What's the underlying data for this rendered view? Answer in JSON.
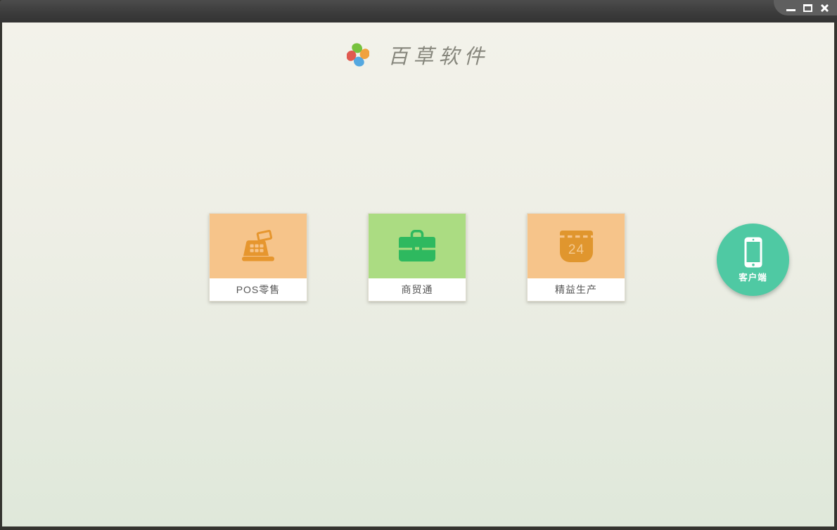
{
  "window": {
    "controls": {
      "minimize_icon": "minimize-icon",
      "maximize_icon": "maximize-icon",
      "close_icon": "close-icon"
    }
  },
  "header": {
    "title": "百草软件",
    "logo_icon": "pinwheel-icon",
    "logo_colors": {
      "top": "#76c23d",
      "right": "#f0a23e",
      "bottom": "#55a8e0",
      "left": "#e05a50"
    }
  },
  "products": [
    {
      "label": "POS零售",
      "icon": "cash-register-icon",
      "tile_color": "#f6c48a",
      "icon_color": "#e6962e"
    },
    {
      "label": "商贸通",
      "icon": "briefcase-icon",
      "tile_color": "#abdc82",
      "icon_color": "#2eb95f"
    },
    {
      "label": "精益生产",
      "icon": "calendar-icon",
      "calendar_day": "24",
      "tile_color": "#f6c48a",
      "icon_color": "#e0962e"
    }
  ],
  "client_button": {
    "label": "客户端",
    "icon": "smartphone-icon",
    "color": "#4fc9a3"
  }
}
